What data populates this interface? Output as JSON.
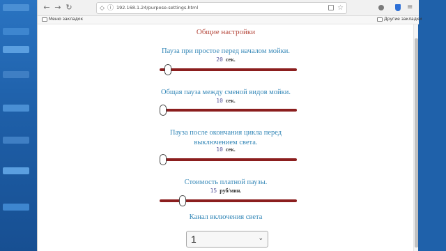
{
  "browser": {
    "url": "192.168.1.24/purpose-settings.html",
    "bookmarks_left": "Меню закладок",
    "bookmarks_right": "Другие закладки"
  },
  "page": {
    "title": "Общие настройки",
    "settings": [
      {
        "label": "Пауза при простое перед началом мойки.",
        "value": "20",
        "unit": "сек.",
        "level": 0.04
      },
      {
        "label": "Общая пауза между сменой видов мойки.",
        "value": "10",
        "unit": "сек.",
        "level": 0.0
      },
      {
        "label": "Пауза после окончания цикла перед выключением света.",
        "value": "10",
        "unit": "сек.",
        "level": 0.0
      },
      {
        "label": "Стоимость платной паузы.",
        "value": "15",
        "unit": "руб/мин.",
        "level": 0.15
      }
    ],
    "channel": {
      "label": "Канал включения света",
      "selected": "1"
    }
  },
  "colors": {
    "title": "#b4473b",
    "label": "#3487b7",
    "track": "#8b1e1e"
  }
}
